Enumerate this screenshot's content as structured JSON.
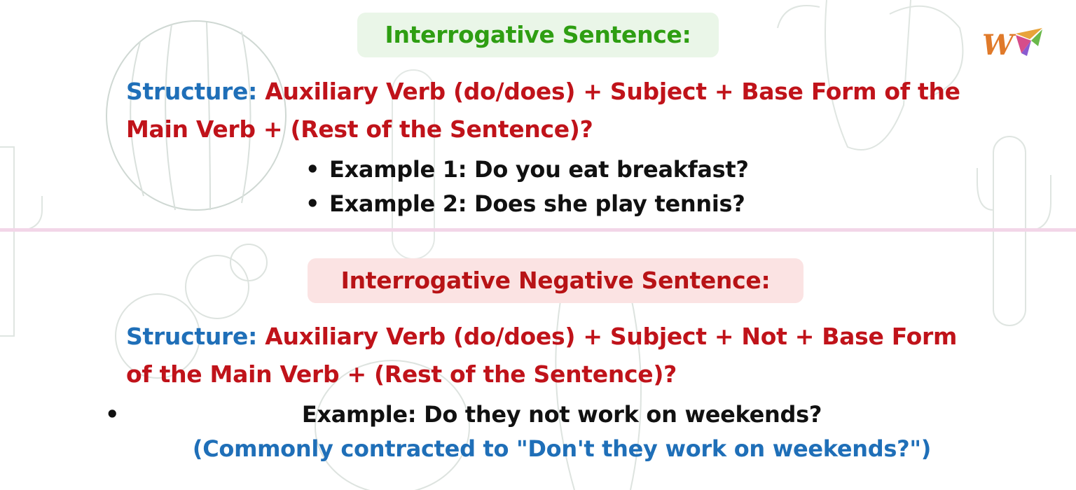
{
  "section1": {
    "heading": "Interrogative Sentence:",
    "structure_label": "Structure:",
    "structure_text": "Auxiliary Verb (do/does) + Subject + Base Form of the Main Verb + (Rest of the Sentence)?",
    "examples": [
      "Example 1: Do you eat breakfast?",
      "Example 2: Does she play tennis?"
    ]
  },
  "section2": {
    "heading": "Interrogative Negative Sentence:",
    "structure_label": "Structure:",
    "structure_text": "Auxiliary Verb (do/does) + Subject + Not + Base Form of the Main Verb + (Rest of the Sentence)?",
    "example": "Example: Do they not work on weekends?",
    "note": "(Commonly contracted to \"Don't they work on weekends?\")"
  },
  "colors": {
    "green_heading": "#2e9e12",
    "red_text": "#c0131a",
    "blue_label": "#1f6fb8",
    "divider": "#f2d6e8"
  },
  "icons": {
    "logo": "brand-logo-w-icon",
    "background": "cactus-pattern-icon"
  }
}
